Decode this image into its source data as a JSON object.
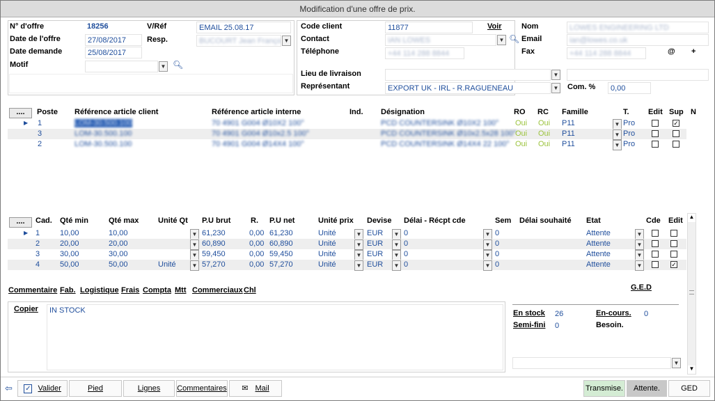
{
  "window": {
    "title": "Modification d'une offre de prix."
  },
  "header": {
    "no_offre_label": "N° d'offre",
    "no_offre": "18256",
    "vref_label": "V/Réf",
    "vref": "EMAIL 25.08.17",
    "date_offre_label": "Date de l'offre",
    "date_offre": "27/08/2017",
    "resp_label": "Resp.",
    "resp": "BUCOURT Jean François",
    "date_demande_label": "Date demande",
    "date_demande": "25/08/2017",
    "motif_label": "Motif",
    "code_client_label": "Code client",
    "code_client": "11877",
    "voir_label": "Voir",
    "contact_label": "Contact",
    "contact": "IAN LOWES",
    "telephone_label": "Téléphone",
    "telephone": "+44 114 288 8844",
    "nom_label": "Nom",
    "nom": "LOWES ENGINEERING LTD",
    "email_label": "Email",
    "email": "ian@lowes.co.uk",
    "fax_label": "Fax",
    "fax": "+44 114 288 8844",
    "at_label": "@",
    "plus_label": "+",
    "lieu_label": "Lieu de livraison",
    "representant_label": "Représentant",
    "representant": "EXPORT UK - IRL - R.RAGUENEAU",
    "com_label": "Com. %",
    "com": "0,00"
  },
  "articles": {
    "dots_label": "....",
    "columns": {
      "poste": "Poste",
      "ref_client": "Référence article client",
      "ref_interne": "Référence article interne",
      "ind": "Ind.",
      "designation": "Désignation",
      "ro": "RO",
      "rc": "RC",
      "famille": "Famille",
      "t": "T.",
      "edit": "Edit",
      "sup": "Sup",
      "n": "N"
    },
    "rows": [
      {
        "poste": "1",
        "ref_client": "LOM-30.500.100",
        "ref_interne": "70 4901 G004 Ø10X2 100°",
        "designation": "PCD COUNTERSINK Ø10X2 100°",
        "ro": "Oui",
        "rc": "Oui",
        "famille": "P11",
        "t": "Pro",
        "edit": false,
        "sup": true
      },
      {
        "poste": "3",
        "ref_client": "LOM-30.500.100",
        "ref_interne": "70 4901 G004 Ø10x2.5 100°",
        "designation": "PCD COUNTERSINK Ø10x2.5x28 100°",
        "ro": "Oui",
        "rc": "Oui",
        "famille": "P11",
        "t": "Pro",
        "edit": false,
        "sup": false
      },
      {
        "poste": "2",
        "ref_client": "LOM-30.500.100",
        "ref_interne": "70 4901 G004 Ø14X4 100°",
        "designation": "PCD COUNTERSINK Ø14X4 22 100°",
        "ro": "Oui",
        "rc": "Oui",
        "famille": "P11",
        "t": "Pro",
        "edit": false,
        "sup": false
      }
    ]
  },
  "quantities": {
    "dots_label": "....",
    "columns": {
      "cad": "Cad.",
      "qte_min": "Qté min",
      "qte_max": "Qté max",
      "unite_qt": "Unité Qt",
      "pu_brut": "P.U brut",
      "r": "R.",
      "pu_net": "P.U net",
      "unite_prix": "Unité prix",
      "devise": "Devise",
      "delai": "Délai - Récpt cde",
      "sem": "Sem",
      "delai_souhaite": "Délai souhaité",
      "etat": "Etat",
      "cde": "Cde",
      "edit": "Edit"
    },
    "rows": [
      {
        "cad": "1",
        "qte_min": "10,00",
        "qte_max": "10,00",
        "unite_qt": "",
        "pu_brut": "61,230",
        "r": "0,00",
        "pu_net": "61,230",
        "unite_prix": "Unité",
        "devise": "EUR",
        "delai": "0",
        "sem": "0",
        "etat": "Attente",
        "cde": false,
        "edit": false
      },
      {
        "cad": "2",
        "qte_min": "20,00",
        "qte_max": "20,00",
        "unite_qt": "",
        "pu_brut": "60,890",
        "r": "0,00",
        "pu_net": "60,890",
        "unite_prix": "Unité",
        "devise": "EUR",
        "delai": "0",
        "sem": "0",
        "etat": "Attente",
        "cde": false,
        "edit": false
      },
      {
        "cad": "3",
        "qte_min": "30,00",
        "qte_max": "30,00",
        "unite_qt": "",
        "pu_brut": "59,450",
        "r": "0,00",
        "pu_net": "59,450",
        "unite_prix": "Unité",
        "devise": "EUR",
        "delai": "0",
        "sem": "0",
        "etat": "Attente",
        "cde": false,
        "edit": false
      },
      {
        "cad": "4",
        "qte_min": "50,00",
        "qte_max": "50,00",
        "unite_qt": "Unité",
        "pu_brut": "57,270",
        "r": "0,00",
        "pu_net": "57,270",
        "unite_prix": "Unité",
        "devise": "EUR",
        "delai": "0",
        "sem": "0",
        "etat": "Attente",
        "cde": false,
        "edit": true
      }
    ]
  },
  "tabs": [
    "Commentaire",
    "Fab.",
    "Logistique",
    "Frais",
    "Compta",
    "Mtt",
    "Commerciaux",
    "Chl"
  ],
  "ged_label": "G.E.D",
  "comment": {
    "copier_label": "Copier",
    "text": "IN STOCK"
  },
  "stock": {
    "en_stock_label": "En stock",
    "en_stock": "26",
    "en_cours_label": "En-cours.",
    "en_cours": "0",
    "semi_fini_label": "Semi-fini",
    "semi_fini": "0",
    "besoin_label": "Besoin."
  },
  "footer": {
    "valider": "Valider",
    "pied": "Pied",
    "lignes": "Lignes",
    "commentaires": "Commentaires",
    "mail": "Mail",
    "transmise": "Transmise.",
    "attente": "Attente.",
    "ged": "GED"
  },
  "colors": {
    "value_blue": "#1f4e9c",
    "green_oui": "#9bc33c",
    "transmise_bg": "#d4ecd4",
    "attente_bg": "#c8c8c8"
  }
}
